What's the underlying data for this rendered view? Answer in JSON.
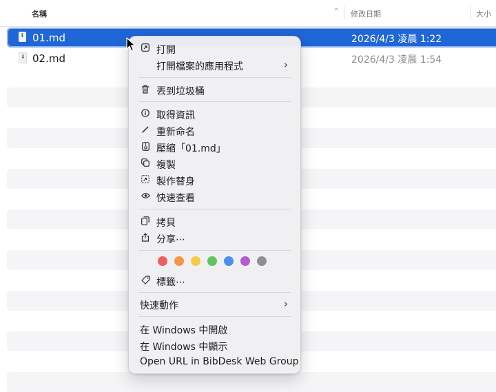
{
  "columns": {
    "name": "名稱",
    "sort_indicator": "^",
    "date_modified": "修改日期",
    "size": "大小"
  },
  "files": [
    {
      "name": "01.md",
      "date": "2026/4/3 凌晨 1:22",
      "selected": true
    },
    {
      "name": "02.md",
      "date": "2026/4/3 凌晨 1:54",
      "selected": false
    }
  ],
  "menu": {
    "open": {
      "label": "打開",
      "icon": "open-arrow-icon"
    },
    "open_with": {
      "label": "打開檔案的應用程式",
      "submenu_icon": "chevron-right-icon"
    },
    "trash": {
      "label": "丟到垃圾桶",
      "icon": "trash-icon"
    },
    "get_info": {
      "label": "取得資訊",
      "icon": "info-icon"
    },
    "rename": {
      "label": "重新命名",
      "icon": "pencil-icon"
    },
    "compress": {
      "label": "壓縮「01.md」",
      "icon": "zip-icon"
    },
    "duplicate": {
      "label": "複製",
      "icon": "duplicate-icon"
    },
    "alias": {
      "label": "製作替身",
      "icon": "alias-icon"
    },
    "quick_look": {
      "label": "快速查看",
      "icon": "eye-icon"
    },
    "copy": {
      "label": "拷貝",
      "icon": "copy-icon"
    },
    "share": {
      "label": "分享⋯",
      "icon": "share-icon"
    },
    "tag_colors": [
      "#ec5f5f",
      "#f2964a",
      "#f6cb45",
      "#5fc362",
      "#4a90e8",
      "#b65ad6",
      "#8e8e93"
    ],
    "tags": {
      "label": "標籤⋯",
      "icon": "tag-icon"
    },
    "quick_actions": {
      "label": "快速動作",
      "submenu_icon": "chevron-right-icon"
    },
    "open_in_windows": {
      "label": "在 Windows 中開啟"
    },
    "show_in_windows": {
      "label": "在 Windows 中顯示"
    },
    "open_url_bibdesk": {
      "label": "Open URL in BibDesk Web Group"
    }
  }
}
